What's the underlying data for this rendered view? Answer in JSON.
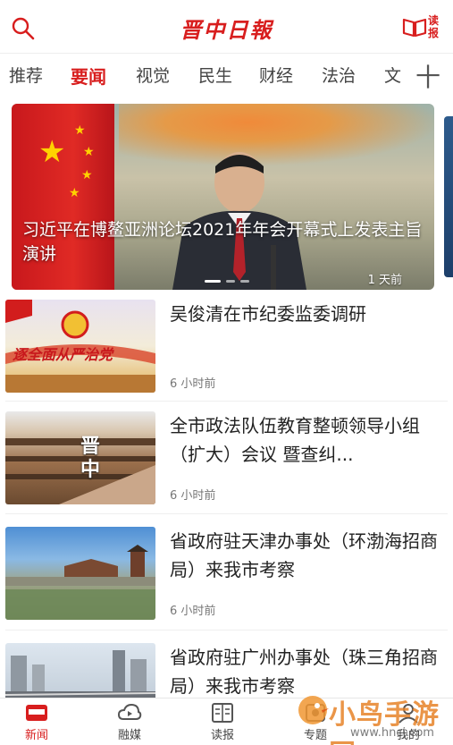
{
  "header": {
    "logo": "晋中日報",
    "reader_label": "读报"
  },
  "tabs": [
    {
      "label": "推荐"
    },
    {
      "label": "要闻"
    },
    {
      "label": "视觉"
    },
    {
      "label": "民生"
    },
    {
      "label": "财经"
    },
    {
      "label": "法治"
    },
    {
      "label": "文"
    }
  ],
  "active_tab": "要闻",
  "add_tab_symbol": "十",
  "banner": {
    "caption": "习近平在博鳌亚洲论坛2021年年会开幕式上发表主旨演讲",
    "time": "1 天前"
  },
  "news": [
    {
      "title": "吴俊清在市纪委监委调研",
      "time": "6 小时前",
      "thumb_text": "逐全面从严治党"
    },
    {
      "title": "全市政法队伍教育整顿领导小组（扩大）会议 暨查纠...",
      "time": "6 小时前",
      "thumb_text": "晋中"
    },
    {
      "title": "省政府驻天津办事处（环渤海招商局）来我市考察",
      "time": "6 小时前",
      "thumb_text": ""
    },
    {
      "title": "省政府驻广州办事处（珠三角招商局）来我市考察",
      "time": "",
      "thumb_text": ""
    }
  ],
  "bottom_nav": [
    {
      "label": "新闻",
      "icon": "news-icon"
    },
    {
      "label": "融媒",
      "icon": "media-icon"
    },
    {
      "label": "读报",
      "icon": "newspaper-icon"
    },
    {
      "label": "专题",
      "icon": "topic-icon"
    },
    {
      "label": "我的",
      "icon": "profile-icon"
    }
  ],
  "watermark": {
    "text": "小鸟手游网",
    "url": "www.hncj.com"
  },
  "colors": {
    "accent": "#d81e1e"
  }
}
